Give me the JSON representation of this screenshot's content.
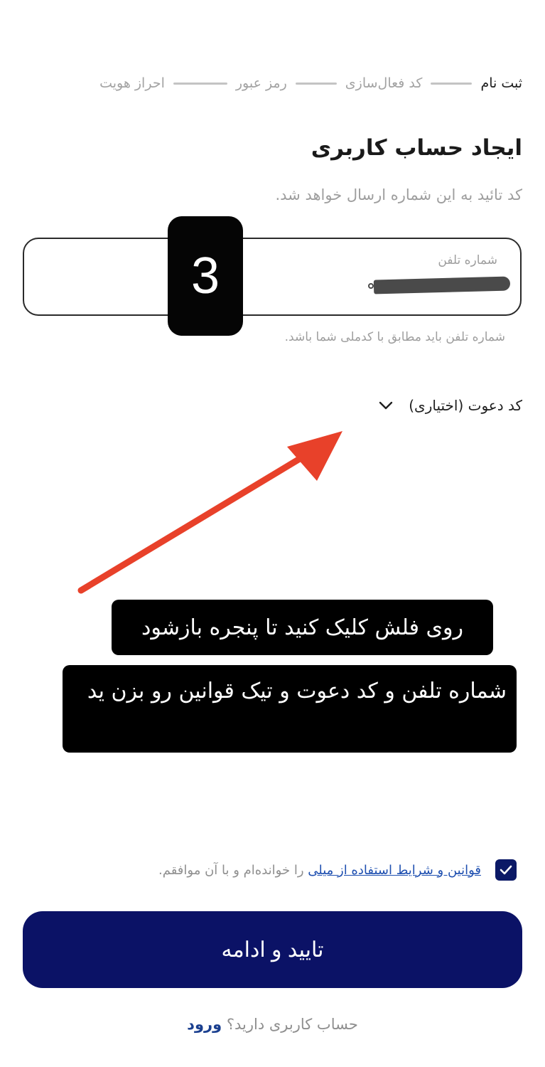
{
  "stepper": {
    "steps": [
      {
        "label": "ثبت نام",
        "active": true
      },
      {
        "label": "کد فعال‌سازی",
        "active": false
      },
      {
        "label": "رمز عبور",
        "active": false
      },
      {
        "label": "احراز هویت",
        "active": false
      }
    ]
  },
  "header": {
    "title": "ایجاد حساب کاربری",
    "subtitle": "کد تائید به این شماره ارسال خواهد شد."
  },
  "phone": {
    "label": "شماره تلفن",
    "hint": "شماره تلفن باید مطابق با کدملی شما باشد."
  },
  "invite": {
    "label": "کد دعوت (اختیاری)"
  },
  "annotations": {
    "badge": "3",
    "instruction_1": "روی فلش کلیک کنید تا پنجره بازشود",
    "instruction_2": "شماره تلفن و کد دعوت و تیک قوانین رو بزن ید",
    "arrow_color": "#e8412a"
  },
  "terms": {
    "checked": true,
    "link_text": "قوانین و شرایط استفاده از میلی",
    "suffix_text": " را خوانده‌ام و با آن موافقم."
  },
  "submit": {
    "label": "تایید و ادامه",
    "color": "#0b1266"
  },
  "login": {
    "prompt": "حساب کاربری دارید؟ ",
    "link": "ورود"
  }
}
